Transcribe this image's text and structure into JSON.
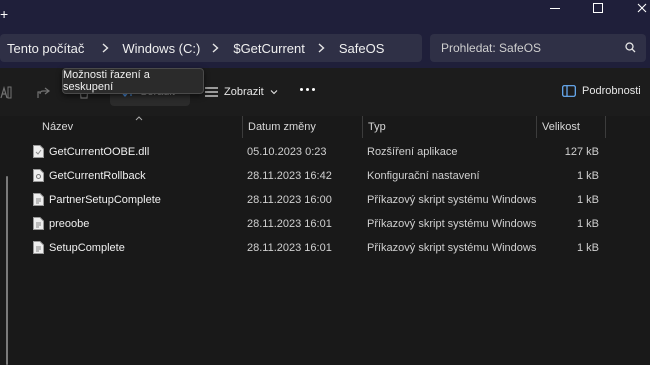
{
  "window": {
    "new_tab_glyph": "+"
  },
  "breadcrumb": {
    "items": [
      "Tento počítač",
      "Windows (C:)",
      "$GetCurrent",
      "SafeOS"
    ]
  },
  "search": {
    "placeholder": "Prohledat: SafeOS"
  },
  "toolbar": {
    "sort_label": "Seřadit",
    "view_label": "Zobrazit",
    "details_label": "Podrobnosti",
    "tooltip": "Možnosti řazení a seskupení"
  },
  "columns": {
    "name": "Název",
    "date": "Datum změny",
    "type": "Typ",
    "size": "Velikost"
  },
  "files": [
    {
      "name": "GetCurrentOOBE.dll",
      "date": "05.10.2023 0:23",
      "type": "Rozšíření aplikace",
      "size": "127 kB"
    },
    {
      "name": "GetCurrentRollback",
      "date": "28.11.2023 16:42",
      "type": "Konfigurační nastavení",
      "size": "1 kB"
    },
    {
      "name": "PartnerSetupComplete",
      "date": "28.11.2023 16:00",
      "type": "Příkazový skript systému Windows",
      "size": "1 kB"
    },
    {
      "name": "preoobe",
      "date": "28.11.2023 16:01",
      "type": "Příkazový skript systému Windows",
      "size": "1 kB"
    },
    {
      "name": "SetupComplete",
      "date": "28.11.2023 16:01",
      "type": "Příkazový skript systému Windows",
      "size": "1 kB"
    }
  ],
  "colors": {
    "titlebar": "#1f1f3a",
    "address_bg": "#2f3046",
    "background": "#191919"
  }
}
